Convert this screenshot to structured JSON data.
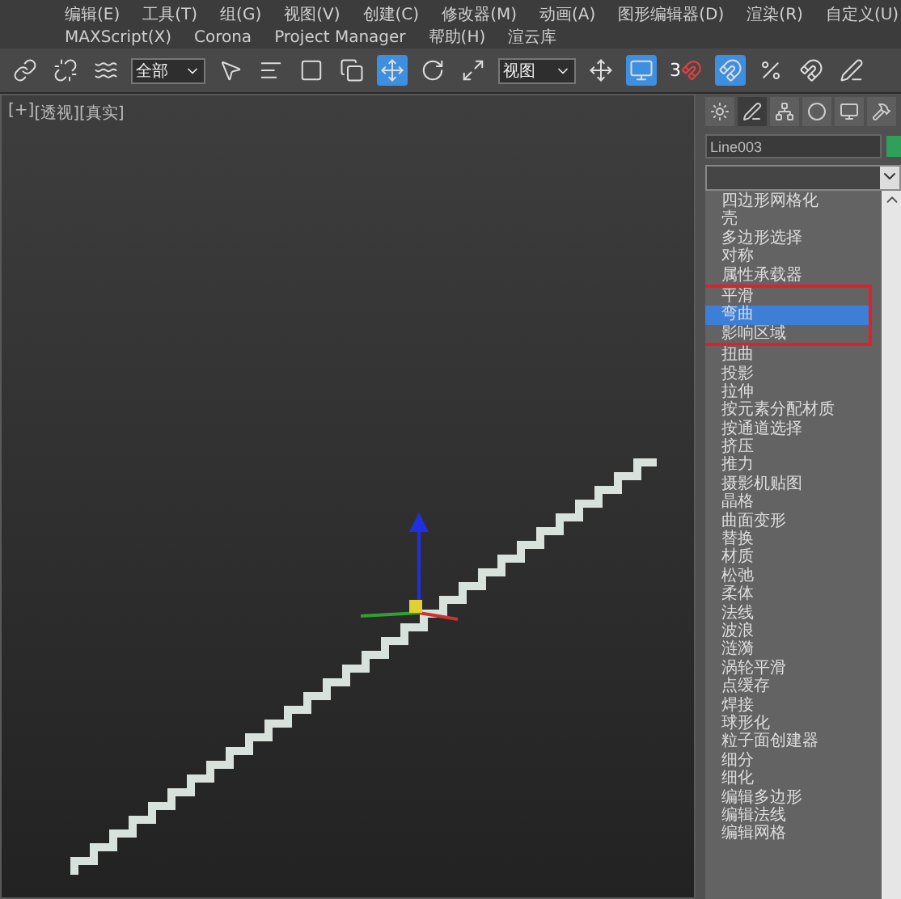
{
  "main_menu": [
    "编辑(E)",
    "工具(T)",
    "组(G)",
    "视图(V)",
    "创建(C)",
    "修改器(M)",
    "动画(A)",
    "图形编辑器(D)",
    "渲染(R)",
    "自定义(U)"
  ],
  "extra_menu": [
    "MAXScript(X)",
    "Corona",
    "Project Manager",
    "帮助(H)",
    "渲云库"
  ],
  "toolbar": {
    "selection_filter": "全部",
    "reference_coordinate": "视图",
    "snap_label": "3"
  },
  "viewport": {
    "labels": [
      "[+]",
      "[透视]",
      "[真实]"
    ]
  },
  "command_panel": {
    "object_name": "Line003",
    "modifier_list": [
      {
        "label": "四边形网格化",
        "selected": false,
        "highlighted": false
      },
      {
        "label": "壳",
        "selected": false,
        "highlighted": false
      },
      {
        "label": "多边形选择",
        "selected": false,
        "highlighted": false
      },
      {
        "label": "对称",
        "selected": false,
        "highlighted": false
      },
      {
        "label": "属性承载器",
        "selected": false,
        "highlighted": false
      },
      {
        "label": "平滑",
        "selected": false,
        "highlighted": true
      },
      {
        "label": "弯曲",
        "selected": true,
        "highlighted": true
      },
      {
        "label": "影响区域",
        "selected": false,
        "highlighted": true
      },
      {
        "label": "扭曲",
        "selected": false,
        "highlighted": false
      },
      {
        "label": "投影",
        "selected": false,
        "highlighted": false
      },
      {
        "label": "拉伸",
        "selected": false,
        "highlighted": false
      },
      {
        "label": "按元素分配材质",
        "selected": false,
        "highlighted": false
      },
      {
        "label": "按通道选择",
        "selected": false,
        "highlighted": false
      },
      {
        "label": "挤压",
        "selected": false,
        "highlighted": false
      },
      {
        "label": "推力",
        "selected": false,
        "highlighted": false
      },
      {
        "label": "摄影机贴图",
        "selected": false,
        "highlighted": false
      },
      {
        "label": "晶格",
        "selected": false,
        "highlighted": false
      },
      {
        "label": "曲面变形",
        "selected": false,
        "highlighted": false
      },
      {
        "label": "替换",
        "selected": false,
        "highlighted": false
      },
      {
        "label": "材质",
        "selected": false,
        "highlighted": false
      },
      {
        "label": "松弛",
        "selected": false,
        "highlighted": false
      },
      {
        "label": "柔体",
        "selected": false,
        "highlighted": false
      },
      {
        "label": "法线",
        "selected": false,
        "highlighted": false
      },
      {
        "label": "波浪",
        "selected": false,
        "highlighted": false
      },
      {
        "label": "涟漪",
        "selected": false,
        "highlighted": false
      },
      {
        "label": "涡轮平滑",
        "selected": false,
        "highlighted": false
      },
      {
        "label": "点缓存",
        "selected": false,
        "highlighted": false
      },
      {
        "label": "焊接",
        "selected": false,
        "highlighted": false
      },
      {
        "label": "球形化",
        "selected": false,
        "highlighted": false
      },
      {
        "label": "粒子面创建器",
        "selected": false,
        "highlighted": false
      },
      {
        "label": "细分",
        "selected": false,
        "highlighted": false
      },
      {
        "label": "细化",
        "selected": false,
        "highlighted": false
      },
      {
        "label": "编辑多边形",
        "selected": false,
        "highlighted": false
      },
      {
        "label": "编辑法线",
        "selected": false,
        "highlighted": false
      },
      {
        "label": "编辑网格",
        "selected": false,
        "highlighted": false
      }
    ]
  }
}
